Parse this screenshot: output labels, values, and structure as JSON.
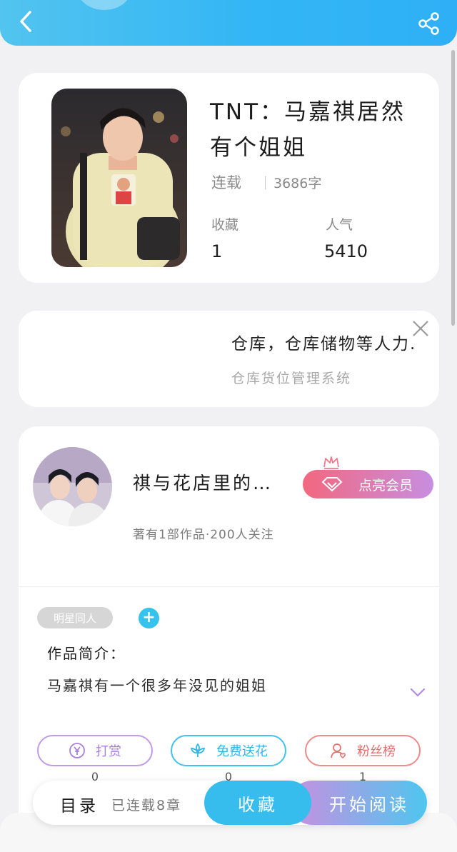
{
  "header": {
    "back_icon": "chevron-left-icon",
    "share_icon": "share-icon",
    "accent": "#33b6f5"
  },
  "book": {
    "title": "TNT：马嘉祺居然有个姐姐",
    "status": "连载",
    "word_count": "3686字",
    "favorites_label": "收藏",
    "favorites_value": "1",
    "popularity_label": "人气",
    "popularity_value": "5410"
  },
  "ad": {
    "headline": "仓库，仓库储物等人力.",
    "subtitle": "仓库货位管理系统",
    "close_icon": "close-icon"
  },
  "author": {
    "name": "祺与花店里的…",
    "vip_label": "点亮会员",
    "meta": "著有1部作品·200人关注",
    "tag": "明星同人",
    "add_tag_symbol": "+",
    "intro_label": "作品简介：",
    "intro_text": "马嘉祺有一个很多年没见的姐姐"
  },
  "actions": [
    {
      "label": "打赏",
      "icon": "yen-icon",
      "count": "0",
      "color": "#b98ee8"
    },
    {
      "label": "免费送花",
      "icon": "flower-icon",
      "count": "0",
      "color": "#3cc2ee"
    },
    {
      "label": "粉丝榜",
      "icon": "fan-icon",
      "count": "1",
      "color": "#ec7d7d"
    }
  ],
  "bottom_bar": {
    "toc_label": "目录",
    "chapters": "已连载8章",
    "collect_label": "收藏",
    "read_label": "开始阅读"
  }
}
